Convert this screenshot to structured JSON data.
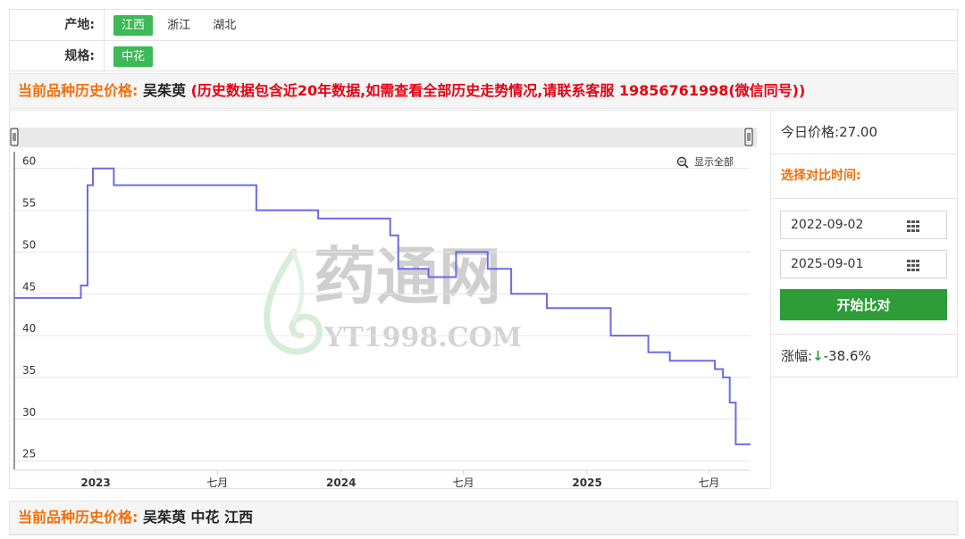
{
  "filters": {
    "origin": {
      "label": "产地:",
      "options": [
        "江西",
        "浙江",
        "湖北"
      ],
      "selected": "江西"
    },
    "spec": {
      "label": "规格:",
      "options": [
        "中花"
      ],
      "selected": "中花"
    }
  },
  "history_bar": {
    "prefix": "当前品种历史价格:",
    "product": "吴茱萸",
    "note": "(历史数据包含近20年数据,如需查看全部历史走势情况,请联系客服 19856761998(微信同号))"
  },
  "zoom": {
    "label": "显示全部",
    "icon": "zoom-out-icon"
  },
  "watermark": {
    "text": "药通网",
    "sub": "YT1998.COM"
  },
  "side": {
    "today_label": "今日价格:",
    "today_value": "27.00",
    "choose_label": "选择对比时间:",
    "date_start": "2022-09-02",
    "date_end": "2025-09-01",
    "button": "开始比对",
    "change_label": "涨幅:",
    "change_arrow": "↓",
    "change_value": "-38.6%",
    "colors": {
      "accent": "#f26f0a",
      "button": "#2e9c37",
      "line": "#6b6be8"
    }
  },
  "footer_bar": {
    "prefix": "当前品种历史价格:",
    "detail": "吴茱萸 中花 江西"
  },
  "chart_data": {
    "type": "line",
    "step": true,
    "x_ticks": [
      {
        "label": "2023",
        "date": "2023-01-01",
        "bold": true
      },
      {
        "label": "七月",
        "date": "2023-07-01",
        "bold": false
      },
      {
        "label": "2024",
        "date": "2024-01-01",
        "bold": true
      },
      {
        "label": "七月",
        "date": "2024-07-01",
        "bold": false
      },
      {
        "label": "2025",
        "date": "2025-01-01",
        "bold": true
      },
      {
        "label": "七月",
        "date": "2025-07-01",
        "bold": false
      }
    ],
    "y_ticks": [
      25,
      30,
      35,
      40,
      45,
      50,
      55,
      60
    ],
    "ylim": [
      24,
      62
    ],
    "xlim": [
      "2022-09-02",
      "2025-09-01"
    ],
    "grid": true,
    "series": [
      {
        "x": [
          "2022-09-02",
          "2022-12-10",
          "2022-12-20",
          "2022-12-28",
          "2023-01-08",
          "2023-01-28",
          "2023-08-28",
          "2023-11-28",
          "2024-03-14",
          "2024-03-26",
          "2024-05-10",
          "2024-06-20",
          "2024-08-06",
          "2024-09-10",
          "2024-11-02",
          "2025-02-05",
          "2025-04-02",
          "2025-05-04",
          "2025-07-10",
          "2025-07-22",
          "2025-08-01",
          "2025-08-10",
          "2025-09-01"
        ],
        "values": [
          44.5,
          46,
          58,
          60,
          60,
          58,
          55,
          54,
          52,
          48,
          47,
          50,
          48,
          45,
          43.3,
          40,
          38,
          37,
          36,
          35,
          32,
          27,
          27
        ]
      }
    ]
  }
}
